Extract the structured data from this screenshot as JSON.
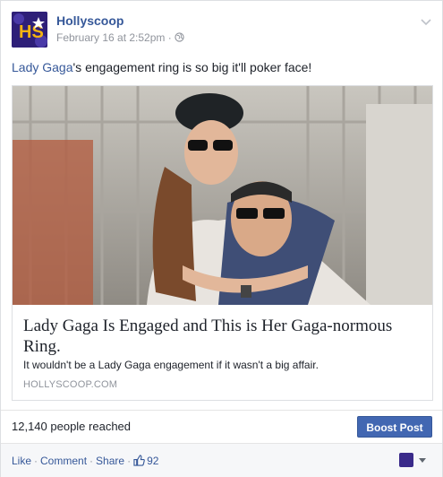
{
  "post": {
    "page_name": "Hollyscoop",
    "timestamp": "February 16 at 2:52pm",
    "separator": "·",
    "privacy_icon": "globe-icon",
    "menu_icon": "chevron-down-icon",
    "avatar_text": "HS"
  },
  "message": {
    "link_text": "Lady Gaga",
    "rest_text": "'s engagement ring is so big it'll poker face!"
  },
  "link_card": {
    "title": "Lady Gaga Is Engaged and This is Her Gaga-normous Ring.",
    "description": "It wouldn't be a Lady Gaga engagement if it wasn't a big affair.",
    "domain": "HOLLYSCOOP.COM"
  },
  "reach": {
    "text": "12,140 people reached",
    "boost_label": "Boost Post"
  },
  "actions": {
    "like": "Like",
    "comment": "Comment",
    "share": "Share",
    "dot": "·",
    "like_count": "92"
  },
  "colors": {
    "link": "#365899",
    "boost": "#4267b2",
    "meta": "#90949c"
  }
}
